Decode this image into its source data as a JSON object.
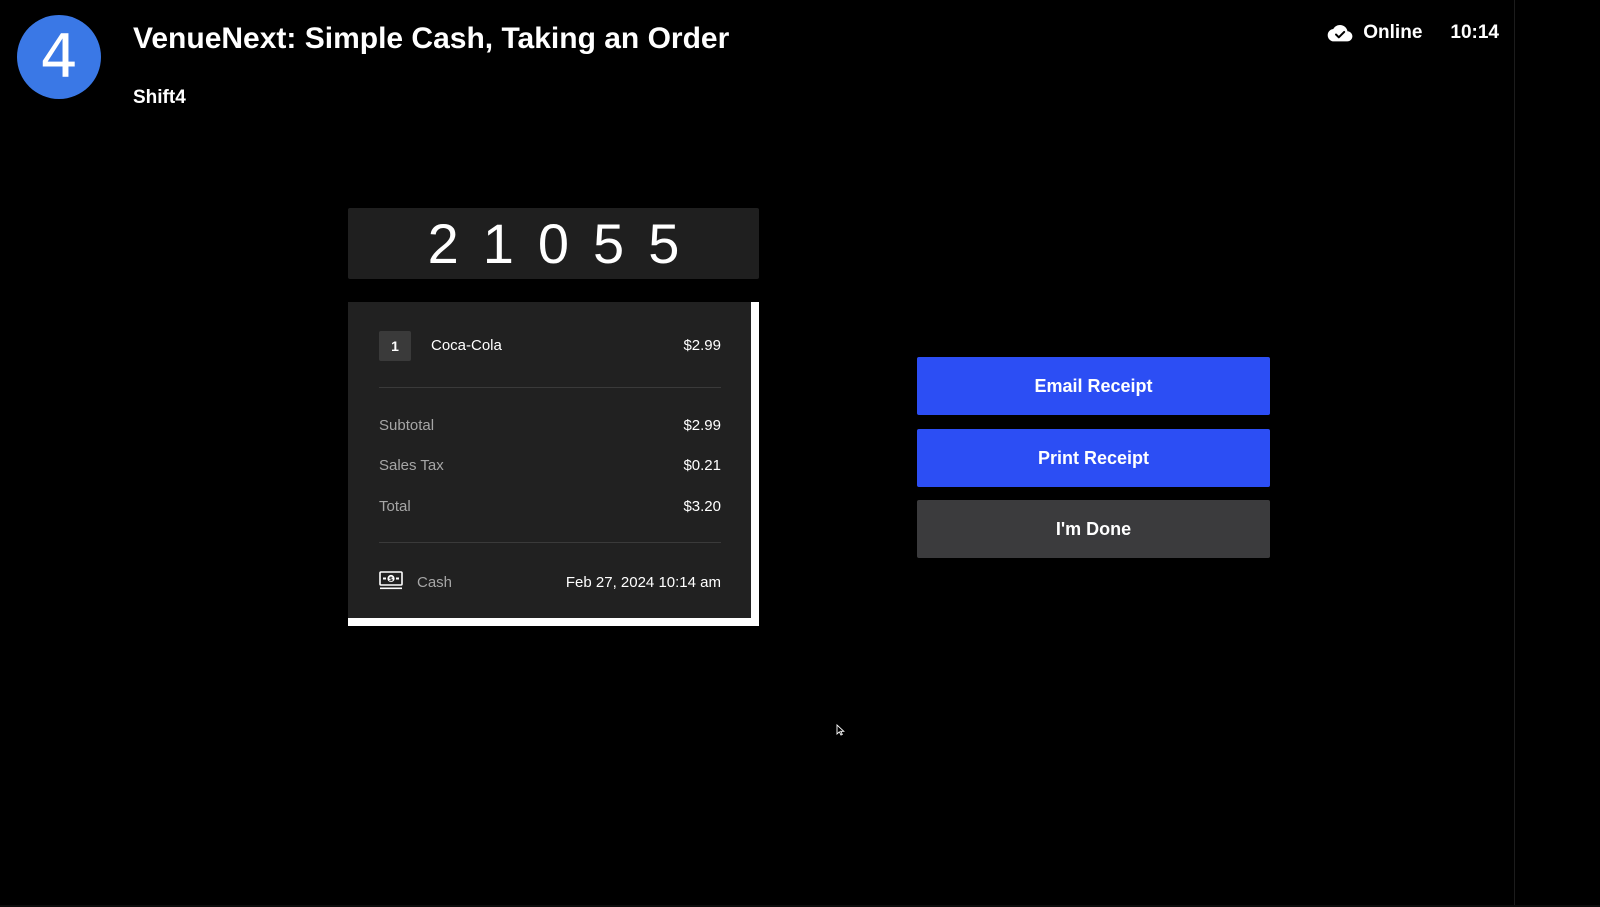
{
  "header": {
    "step_number": "4",
    "video_title": "VenueNext: Simple Cash, Taking an Order",
    "channel_name": "Shift4"
  },
  "status_bar": {
    "connection_icon": "cloud-check-icon",
    "connection_status": "Online",
    "time": "10:14"
  },
  "order": {
    "number": "21055"
  },
  "receipt": {
    "items": [
      {
        "quantity": "1",
        "name": "Coca-Cola",
        "price": "$2.99"
      }
    ],
    "subtotal_label": "Subtotal",
    "subtotal_value": "$2.99",
    "tax_label": "Sales Tax",
    "tax_value": "$0.21",
    "total_label": "Total",
    "total_value": "$3.20",
    "payment_icon": "cash-icon",
    "payment_method": "Cash",
    "payment_date": "Feb 27, 2024 10:14 am"
  },
  "actions": {
    "email_receipt": "Email Receipt",
    "print_receipt": "Print Receipt",
    "done": "I'm Done"
  },
  "colors": {
    "background": "#000000",
    "primary_button": "#2c4ef4",
    "secondary_button": "#3b3b3d",
    "avatar": "#3a78e6",
    "panel": "#212121"
  }
}
